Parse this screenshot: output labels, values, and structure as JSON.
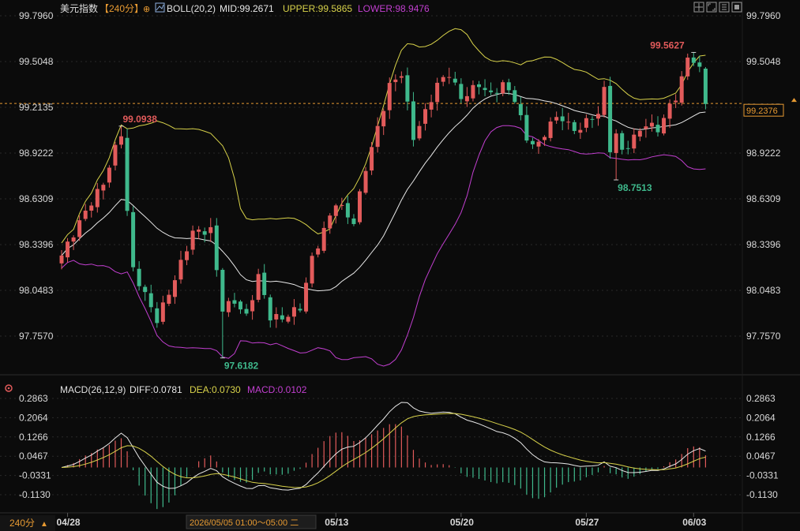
{
  "header": {
    "symbol": "美元指数",
    "period_bracket": "【240分】",
    "indicator_name": "BOLL(20,2)",
    "mid_text": "MID:99.2671",
    "upper_text": "UPPER:99.5865",
    "lower_text": "LOWER:98.9476"
  },
  "macd_header": {
    "indicator_name": "MACD(26,12,9)",
    "diff_text": "DIFF:0.0781",
    "dea_text": "DEA:0.0730",
    "macd_text": "MACD:0.0102"
  },
  "footer": {
    "period_label": "240分",
    "cursor_time": "2026/05/05 01:00～05:00 二"
  },
  "colors": {
    "background": "#0b0b0b",
    "grid": "#2a2a2a",
    "up": "#e25b5b",
    "down": "#3fb98c",
    "mid": "#e8e8e8",
    "upper": "#d8d24a",
    "lower": "#c23fd0",
    "last_price": "#e79a32"
  },
  "chart_data": {
    "type": "candlestick",
    "symbol": "美元指数",
    "period": "240分",
    "price_axis": {
      "ticks": [
        "99.7960",
        "99.5048",
        "99.2135",
        "98.9222",
        "98.6309",
        "98.3396",
        "98.0483",
        "97.7570"
      ],
      "range": [
        97.62,
        99.796
      ]
    },
    "x_labels": [
      {
        "index": 1,
        "label": "04/28"
      },
      {
        "index": 46,
        "label": "05/13"
      },
      {
        "index": 67,
        "label": "05/20"
      },
      {
        "index": 88,
        "label": "05/27"
      },
      {
        "index": 106,
        "label": "06/03"
      }
    ],
    "last_price": "99.2376",
    "annotations": [
      {
        "label": "99.0938",
        "index": 10,
        "value": 99.0938,
        "kind": "high"
      },
      {
        "label": "97.6182",
        "index": 27,
        "value": 97.6182,
        "kind": "low"
      },
      {
        "label": "98.7513",
        "index": 93,
        "value": 98.7513,
        "kind": "low"
      },
      {
        "label": "99.5627",
        "index": 106,
        "value": 99.5627,
        "kind": "high"
      }
    ],
    "close_anchors": [
      [
        0,
        98.27
      ],
      [
        4,
        98.55
      ],
      [
        7,
        98.73
      ],
      [
        9,
        98.95
      ],
      [
        10,
        99.05
      ],
      [
        11,
        98.55
      ],
      [
        12,
        98.18
      ],
      [
        14,
        98.02
      ],
      [
        16,
        97.86
      ],
      [
        19,
        98.12
      ],
      [
        22,
        98.42
      ],
      [
        25,
        98.43
      ],
      [
        27,
        97.93
      ],
      [
        29,
        97.98
      ],
      [
        31,
        97.88
      ],
      [
        33,
        98.14
      ],
      [
        35,
        97.88
      ],
      [
        37,
        97.87
      ],
      [
        40,
        97.94
      ],
      [
        42,
        98.25
      ],
      [
        44,
        98.43
      ],
      [
        46,
        98.61
      ],
      [
        49,
        98.48
      ],
      [
        51,
        98.83
      ],
      [
        53,
        99.08
      ],
      [
        55,
        99.35
      ],
      [
        57,
        99.43
      ],
      [
        59,
        99.02
      ],
      [
        61,
        99.18
      ],
      [
        63,
        99.36
      ],
      [
        65,
        99.43
      ],
      [
        67,
        99.27
      ],
      [
        70,
        99.36
      ],
      [
        72,
        99.29
      ],
      [
        74,
        99.36
      ],
      [
        76,
        99.27
      ],
      [
        78,
        99.01
      ],
      [
        80,
        98.97
      ],
      [
        82,
        99.12
      ],
      [
        84,
        99.15
      ],
      [
        86,
        99.06
      ],
      [
        88,
        99.12
      ],
      [
        90,
        99.18
      ],
      [
        91,
        99.32
      ],
      [
        92,
        98.95
      ],
      [
        93,
        99.04
      ],
      [
        94,
        98.93
      ],
      [
        96,
        99.02
      ],
      [
        98,
        99.11
      ],
      [
        100,
        99.07
      ],
      [
        101,
        99.15
      ],
      [
        103,
        99.28
      ],
      [
        105,
        99.52
      ],
      [
        106,
        99.52
      ],
      [
        107,
        99.45
      ],
      [
        108,
        99.24
      ]
    ],
    "bollinger": {
      "period": 20,
      "mult": 2,
      "mid": 99.2671,
      "upper": 99.5865,
      "lower": 98.9476
    },
    "macd": {
      "params": [
        26,
        12,
        9
      ],
      "diff": 0.0781,
      "dea": 0.073,
      "macd": 0.0102,
      "axis_ticks": [
        "0.2863",
        "0.2064",
        "0.1266",
        "0.0467",
        "-0.0331",
        "-0.1130"
      ]
    }
  }
}
